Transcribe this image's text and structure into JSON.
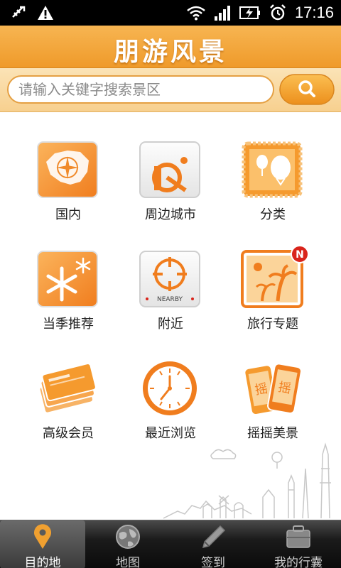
{
  "status_bar": {
    "time": "17:16",
    "icons": [
      "usb-debug-icon",
      "warning-icon",
      "wifi-icon",
      "signal-icon",
      "battery-charging-icon",
      "alarm-icon"
    ]
  },
  "header": {
    "title": "朋游风景"
  },
  "search": {
    "placeholder": "请输入关键字搜索景区",
    "value": "",
    "button_icon": "search-icon"
  },
  "grid": {
    "items": [
      {
        "label": "国内",
        "icon": "china-map-compass-icon"
      },
      {
        "label": "周边城市",
        "icon": "nearby-cities-icon"
      },
      {
        "label": "分类",
        "icon": "categories-balloon-icon"
      },
      {
        "label": "当季推荐",
        "icon": "seasonal-snowflake-icon"
      },
      {
        "label": "附近",
        "icon": "nearby-crosshair-icon",
        "badge_text": "NEARBY"
      },
      {
        "label": "旅行专题",
        "icon": "travel-topics-palm-icon",
        "badge": "N"
      },
      {
        "label": "高级会员",
        "icon": "vip-cards-icon"
      },
      {
        "label": "最近浏览",
        "icon": "recent-clock-icon"
      },
      {
        "label": "摇摇美景",
        "icon": "shake-phones-icon",
        "icon_text": "摇"
      }
    ]
  },
  "tabbar": {
    "active": 0,
    "tabs": [
      {
        "label": "目的地",
        "icon": "location-pin-icon"
      },
      {
        "label": "地图",
        "icon": "globe-icon"
      },
      {
        "label": "签到",
        "icon": "pen-icon"
      },
      {
        "label": "我的行囊",
        "icon": "suitcase-icon"
      }
    ]
  },
  "colors": {
    "accent": "#f09a2a",
    "header_top": "#f7b552",
    "tab_bg": "#111111",
    "badge_red": "#d9241b"
  }
}
